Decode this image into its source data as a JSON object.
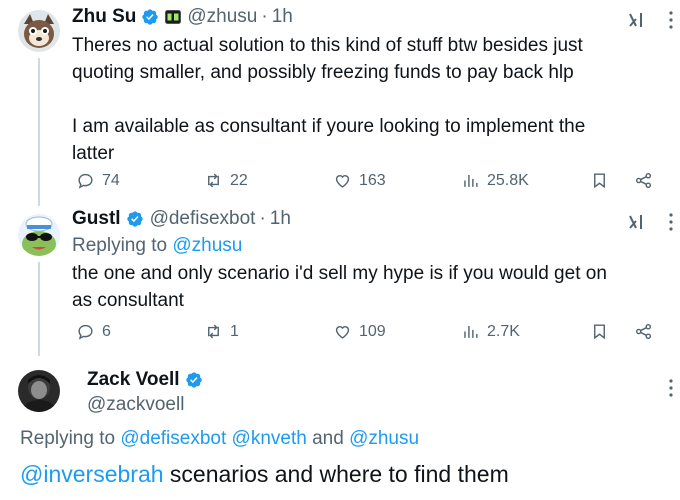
{
  "colors": {
    "link": "#1d9bf0",
    "muted": "#536471",
    "text": "#0f1419",
    "verified": "#1d9bf0",
    "line": "#cfd9de"
  },
  "tweets": [
    {
      "name": "Zhu Su",
      "handle": "@zhusu",
      "time": "1h",
      "affiliation_icon": "exchange-badge-icon",
      "text_lines": [
        "Theres no actual solution to this kind of stuff btw besides just",
        "quoting smaller, and possibly freezing funds to pay back hlp",
        "",
        "I am available as consultant if youre looking to implement the",
        "latter"
      ],
      "stats": {
        "replies": "74",
        "reposts": "22",
        "likes": "163",
        "views": "25.8K"
      }
    },
    {
      "name": "Gustl",
      "handle": "@defisexbot",
      "time": "1h",
      "replying_prefix": "Replying to",
      "replying_to": "@zhusu",
      "text_lines": [
        "the one and only scenario i'd sell my hype is if you would get on",
        "as consultant"
      ],
      "stats": {
        "replies": "6",
        "reposts": "1",
        "likes": "109",
        "views": "2.7K"
      }
    }
  ],
  "focal": {
    "name": "Zack Voell",
    "handle": "@zackvoell",
    "replying_prefix": "Replying to",
    "replying_mentions": [
      "@defisexbot",
      "@knveth",
      "@zhusu"
    ],
    "replying_and": "and",
    "text_mention": "@inversebrah",
    "text_rest": " scenarios and where to find them"
  }
}
